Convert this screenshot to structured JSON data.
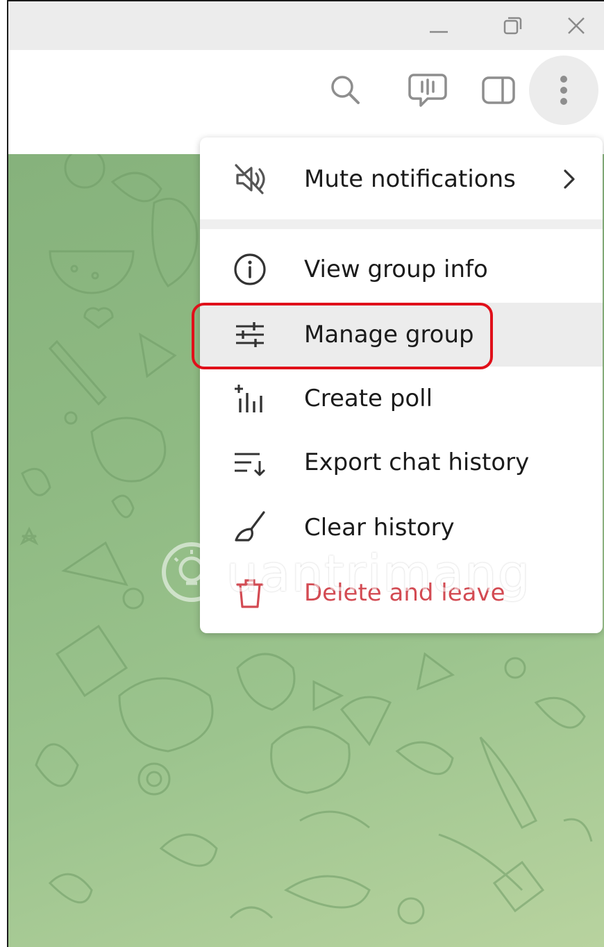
{
  "window": {
    "buttons": [
      {
        "name": "minimize",
        "icon": "minimize-icon"
      },
      {
        "name": "restore",
        "icon": "restore-icon"
      },
      {
        "name": "close",
        "icon": "close-icon"
      }
    ]
  },
  "header": {
    "actions": [
      {
        "name": "search",
        "icon": "search-icon"
      },
      {
        "name": "voice-chat",
        "icon": "voice-chat-icon"
      },
      {
        "name": "sidebar-toggle",
        "icon": "sidebar-toggle-icon"
      },
      {
        "name": "more-options",
        "icon": "more-vertical-icon",
        "active": true
      }
    ]
  },
  "menu": {
    "items": [
      {
        "label": "Mute notifications",
        "icon": "mute-icon",
        "has_submenu": true
      },
      {
        "label": "View group info",
        "icon": "info-icon"
      },
      {
        "label": "Manage group",
        "icon": "sliders-icon",
        "hovered": true
      },
      {
        "label": "Create poll",
        "icon": "poll-icon"
      },
      {
        "label": "Export chat history",
        "icon": "export-icon"
      },
      {
        "label": "Clear history",
        "icon": "broom-icon"
      },
      {
        "label": "Delete and leave",
        "icon": "trash-icon",
        "danger": true
      }
    ]
  },
  "watermark": {
    "text": "uantrimang"
  },
  "colors": {
    "danger": "#d34a52",
    "highlight_border": "#e0101a",
    "hover_bg": "#ececec",
    "wallpaper": "#8fba83"
  }
}
